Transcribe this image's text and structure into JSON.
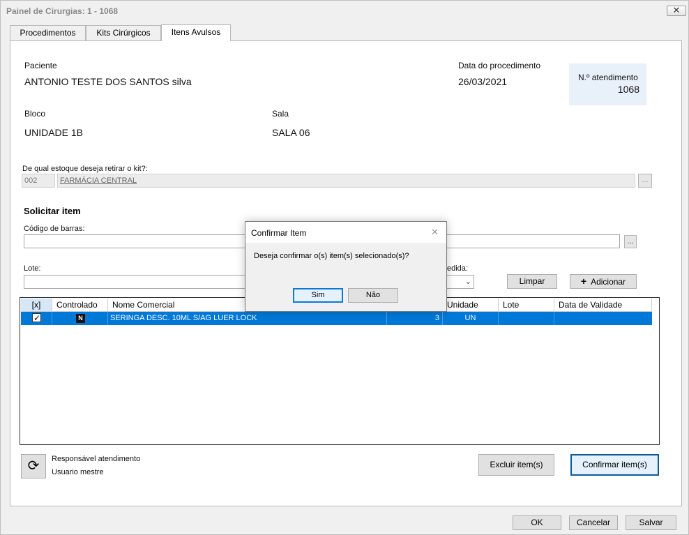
{
  "window": {
    "title": "Painel de Cirurgias: 1 - 1068",
    "close_glyph": "✕"
  },
  "tabs": [
    {
      "label": "Procedimentos",
      "active": false
    },
    {
      "label": "Kits Cirúrgicos",
      "active": false
    },
    {
      "label": "Itens Avulsos",
      "active": true
    }
  ],
  "patient": {
    "paciente_label": "Paciente",
    "paciente_value": "ANTONIO TESTE DOS SANTOS silva",
    "data_label": "Data do procedimento",
    "data_value": "26/03/2021",
    "atendimento_label": "N.º atendimento",
    "atendimento_value": "1068",
    "bloco_label": "Bloco",
    "bloco_value": "UNIDADE 1B",
    "sala_label": "Sala",
    "sala_value": "SALA 06"
  },
  "estoque": {
    "label": "De qual estoque deseja retirar o kit?:",
    "code": "002",
    "name": "FARMÁCIA CENTRAL",
    "lookup_label": "..."
  },
  "solicitar": {
    "heading": "Solicitar item",
    "barcode_label": "Código de barras:",
    "barcode_value": "",
    "barcode_lookup": "...",
    "lote_label": "Lote:",
    "lote_value": "",
    "medida_label": "edida:",
    "limpar_label": "Limpar",
    "adicionar_label": "Adicionar",
    "adicionar_icon": "+"
  },
  "grid": {
    "columns": [
      "[x]",
      "Controlado",
      "Nome Comercial",
      "",
      "Unidade",
      "Lote",
      "Data de Validade"
    ],
    "rows": [
      {
        "checked": true,
        "controlado": "N",
        "nome": "SERINGA DESC. 10ML S/AG LUER LOCK",
        "quantidade": "3",
        "unidade": "UN",
        "lote": "",
        "validade": ""
      }
    ]
  },
  "footer": {
    "responsavel_label": "Responsável atendimento",
    "responsavel_value": "Usuario mestre",
    "excluir_label": "Excluir item(s)",
    "confirmar_label": "Confirmar item(s)",
    "ok_label": "OK",
    "cancelar_label": "Cancelar",
    "salvar_label": "Salvar"
  },
  "dialog": {
    "title": "Confirmar Item",
    "message": "Deseja confirmar o(s) item(s) selecionado(s)?",
    "yes_label": "Sim",
    "no_label": "Não",
    "close_glyph": "✕"
  },
  "colors": {
    "selection": "#0078d7",
    "info_box": "#e8f0fa",
    "panel": "#ffffff"
  }
}
